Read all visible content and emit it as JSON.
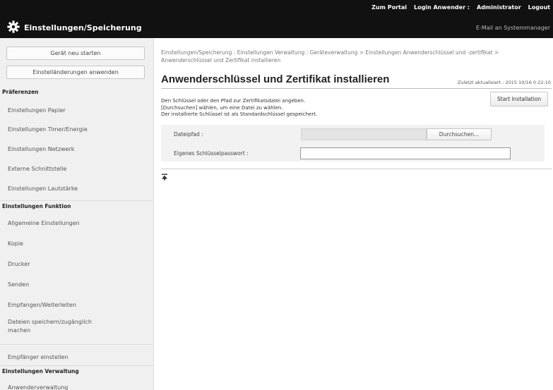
{
  "header": {
    "links": [
      "Zum Portal",
      "Login Anwender :",
      "Administrator",
      "Logout"
    ],
    "title": "Einstellungen/Speicherung",
    "mail_link": "E-Mail an Systemmanager",
    "gear_icon": "gear-icon"
  },
  "sidebar": {
    "buttons": [
      "Gerät neu starten",
      "Einstelländerungen anwenden"
    ],
    "sections": [
      {
        "heading": "Präferenzen",
        "items": [
          "Einstellungen Papier",
          "Einstellungen Timer/Energie",
          "Einstellungen Netzwerk",
          "Externe Schnittstelle",
          "Einstellungen Lautstärke"
        ]
      },
      {
        "heading": "Einstellungen Funktion",
        "items": [
          "Allgemeine Einstellungen",
          "Kopie",
          "Drucker",
          "Senden",
          "Empfangen/Weiterleiten",
          "Dateien speichern/zugänglich machen",
          "Empfänger einstellen"
        ]
      },
      {
        "heading": "Einstellungen Verwaltung",
        "items": [
          "Anwenderverwaltung"
        ]
      }
    ]
  },
  "main": {
    "breadcrumb": "Einstellungen/Speicherung : Einstellungen Verwaltung : Geräteverwaltung > Einstellungen Anwenderschlüssel und -zertifikat > Anwenderschlüssel und Zertifikat installieren",
    "title": "Anwenderschlüssel und Zertifikat installieren",
    "updated": "Zuletzt aktualisiert : 2015 10/16 0:22:10",
    "description": [
      "Den Schlüssel oder den Pfad zur Zertifikatsdatei angeben.",
      "[Durchsuchen] wählen, um eine Datei zu wählen.",
      "Der installierte Schlüssel ist als Standardschlüssel gespeichert."
    ],
    "start_button": "Start Installation",
    "form": {
      "file_path_label": "Dateipfad :",
      "file_path_value": "",
      "browse_button": "Durchsuchen...",
      "password_label": "Eigenes Schlüsselpasswort :",
      "password_value": ""
    },
    "to_top_icon": "to-top-icon"
  },
  "colors": {
    "header_bg": "#111111",
    "sidebar_bg": "#f0f0f0",
    "form_bg": "#f2f2f2"
  }
}
